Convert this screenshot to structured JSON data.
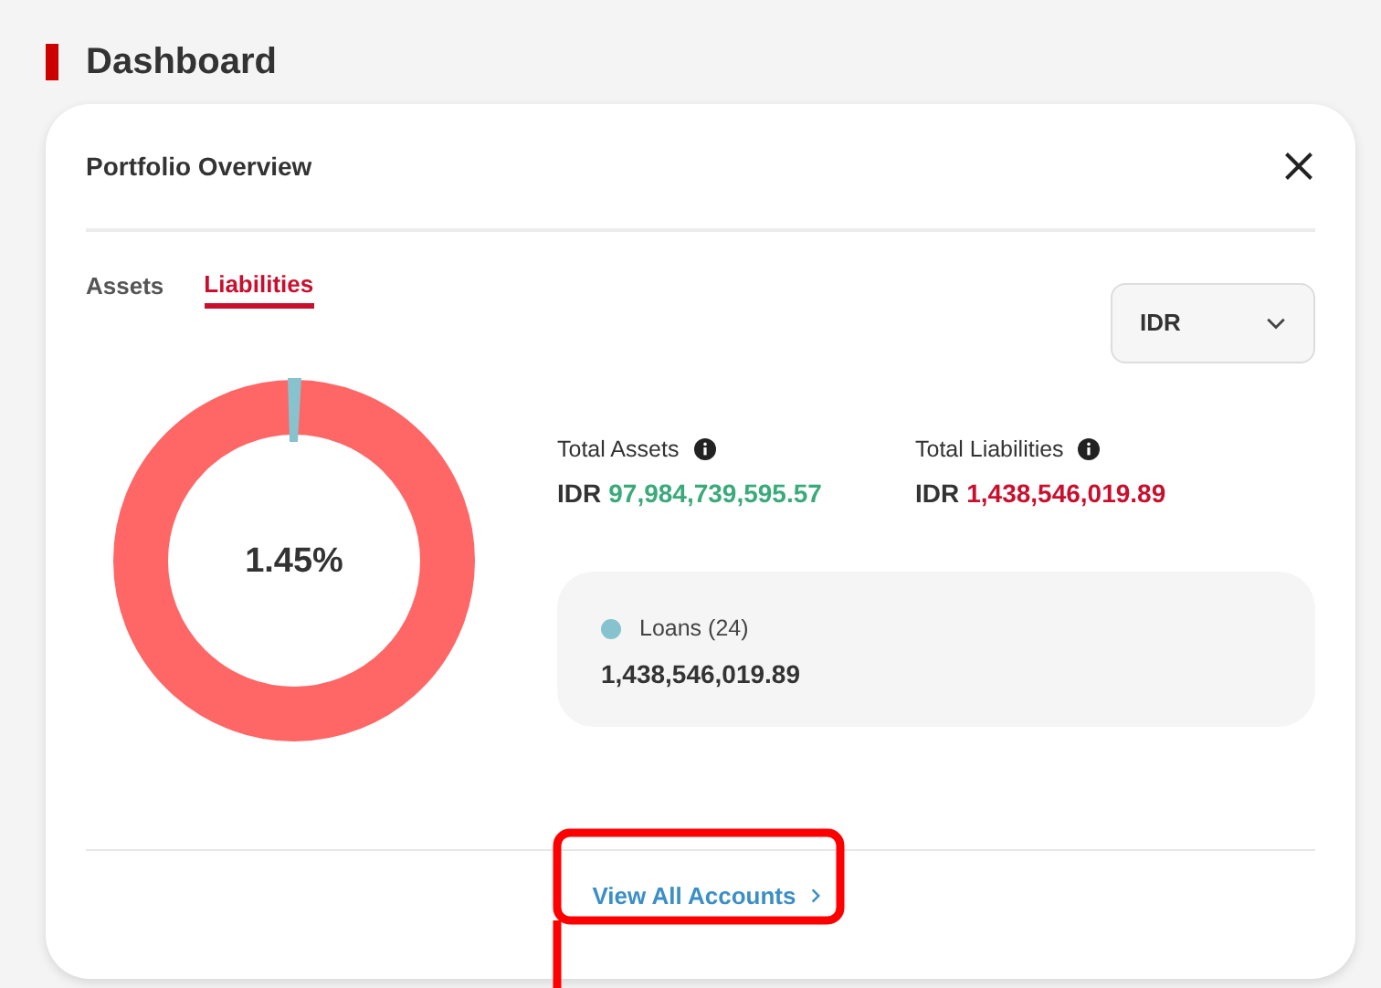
{
  "page": {
    "title": "Dashboard"
  },
  "card": {
    "title": "Portfolio Overview",
    "tabs": [
      {
        "label": "Assets",
        "selected": false
      },
      {
        "label": "Liabilities",
        "selected": true
      }
    ],
    "currency_select": {
      "value": "IDR"
    },
    "donut": {
      "center_label": "1.45%"
    },
    "totals": [
      {
        "label": "Total Assets",
        "currency": "IDR",
        "amount": "97,984,739,595.57",
        "kind": "asset"
      },
      {
        "label": "Total Liabilities",
        "currency": "IDR",
        "amount": "1,438,546,019.89",
        "kind": "liability"
      }
    ],
    "categories": [
      {
        "label": "Loans (24)",
        "amount": "1,438,546,019.89",
        "color": "#86c3cf"
      }
    ],
    "link": "View All Accounts"
  },
  "annotation": {
    "kind": "highlight"
  }
}
